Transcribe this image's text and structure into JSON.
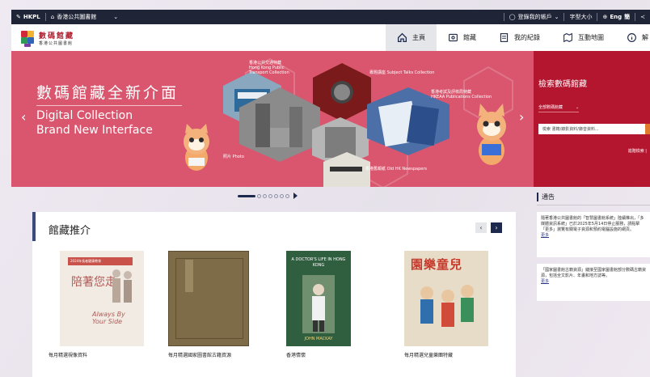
{
  "topbar": {
    "brand": "HKPL",
    "org": "香港公共圖書館",
    "account": "登錄我的帳戶",
    "font_size": "字型大小",
    "lang_en": "Eng",
    "lang_zh": "簡"
  },
  "header": {
    "logo_zh": "數碼館藏",
    "logo_sub": "香港公共圖書館",
    "nav": [
      {
        "label": "主頁",
        "icon": "home-icon"
      },
      {
        "label": "館藏",
        "icon": "collection-icon"
      },
      {
        "label": "我的紀錄",
        "icon": "record-icon"
      },
      {
        "label": "互動地圖",
        "icon": "map-icon"
      },
      {
        "label": "解",
        "icon": "info-icon"
      }
    ]
  },
  "hero": {
    "title_zh": "數碼館藏全新介面",
    "title_en_1": "Digital Collection",
    "title_en_2": "Brand New Interface",
    "labels": [
      {
        "zh": "香港公共交通特藏",
        "en": "Hong Kong Public",
        "en2": "Transport Collection"
      },
      {
        "zh": "專題講座",
        "en": "Subject Talks Collection"
      },
      {
        "zh": "香港考試及評核局特藏",
        "en": "HKEAA Publications Collection"
      },
      {
        "zh": "照片",
        "en": "Photo"
      },
      {
        "zh": "香港舊報紙",
        "en": "Old HK Newspapers"
      }
    ]
  },
  "search": {
    "title": "檢索數碼館藏",
    "select": "全部數碼館藏",
    "placeholder": "檢索 書籍/錄影資料/錄音資料...",
    "advanced": "進階檢索"
  },
  "recommend": {
    "title": "館藏推介",
    "items": [
      {
        "caption": "每月精選視像資料",
        "cover_top": "2024年長者健康教育",
        "cover_main": "陪著您走",
        "cover_en": "Always By Your Side"
      },
      {
        "caption": "每月精選國家圖書館古籍資源"
      },
      {
        "caption": "香港情懷",
        "cover_main": "A DOCTOR'S LIFE IN HONG KONG",
        "cover_author": "JOHN MACKAY"
      },
      {
        "caption": "每月精選兒童樂團特藏",
        "cover_main": "園樂童兒"
      }
    ]
  },
  "notices": {
    "title": "通告",
    "items": [
      {
        "text": "隨著香港公共圖書館的「智慧圖書館系統」陸續推出，「多媒體資訊系統」已於2025年5月14日停止服務，請點擊「更多」瀏覽有關電子資源和預約電腦設施的網頁。",
        "more": "更多"
      },
      {
        "text": "「國家圖書館古籍資源」鏈接至國家圖書館部分數碼古籍資源，包括全文影片、年畫和地方誌等。",
        "more": "更多"
      }
    ]
  },
  "colors": {
    "hero": "#d9566e",
    "search": "#b4152f",
    "topbar": "#1f2437"
  }
}
